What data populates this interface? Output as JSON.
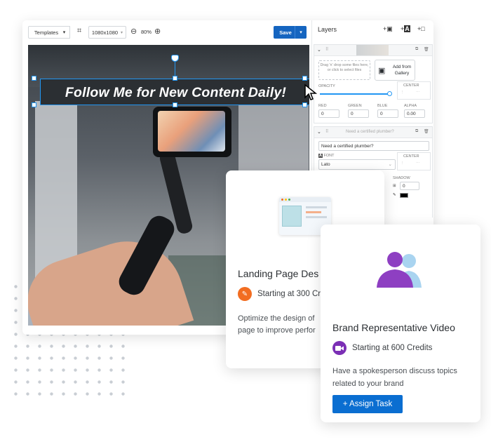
{
  "toolbar": {
    "templates_label": "Templates",
    "caret": "▾",
    "size": "1080x1080",
    "zoom": "80%",
    "save_label": "Save"
  },
  "canvas": {
    "headline": "Follow Me for New Content Daily!"
  },
  "panel": {
    "title": "Layers",
    "image_layer": {
      "drop_text": "Drag 'n' drop some files here, or click to select files",
      "gallery_label": "Add from Gallery",
      "opacity_label": "OPACITY",
      "center_label": "CENTER",
      "red_label": "RED",
      "green_label": "GREEN",
      "blue_label": "BLUE",
      "alpha_label": "ALPHA",
      "red": "0",
      "green": "0",
      "blue": "0",
      "alpha": "0.00"
    },
    "text_layer": {
      "placeholder": "Need a certified plumber?",
      "text_value": "Need a certified plumber?",
      "font_label": "FONT",
      "font_value": "Lato",
      "center_label": "CENTER",
      "shadow_label": "SHADOW",
      "shadow_value": "0"
    }
  },
  "cards": [
    {
      "title": "Landing Page Des",
      "credits": "Starting at 300 Cr",
      "description_line1": "Optimize the design of",
      "description_line2": "page to improve perfor",
      "icon": "brush-icon",
      "icon_color": "#f26d21"
    },
    {
      "title": "Brand Representative Video",
      "credits": "Starting at 600 Credits",
      "description_line1": "Have a spokesperson discuss topics",
      "description_line2": "related to your brand",
      "icon": "video-camera-icon",
      "icon_color": "#7b2fb5",
      "button_label": "+ Assign Task"
    }
  ],
  "colors": {
    "primary": "#1565c0",
    "selection": "#2196f3",
    "avatar_purple": "#8e3fc2",
    "avatar_blue": "#a9d4f0"
  }
}
